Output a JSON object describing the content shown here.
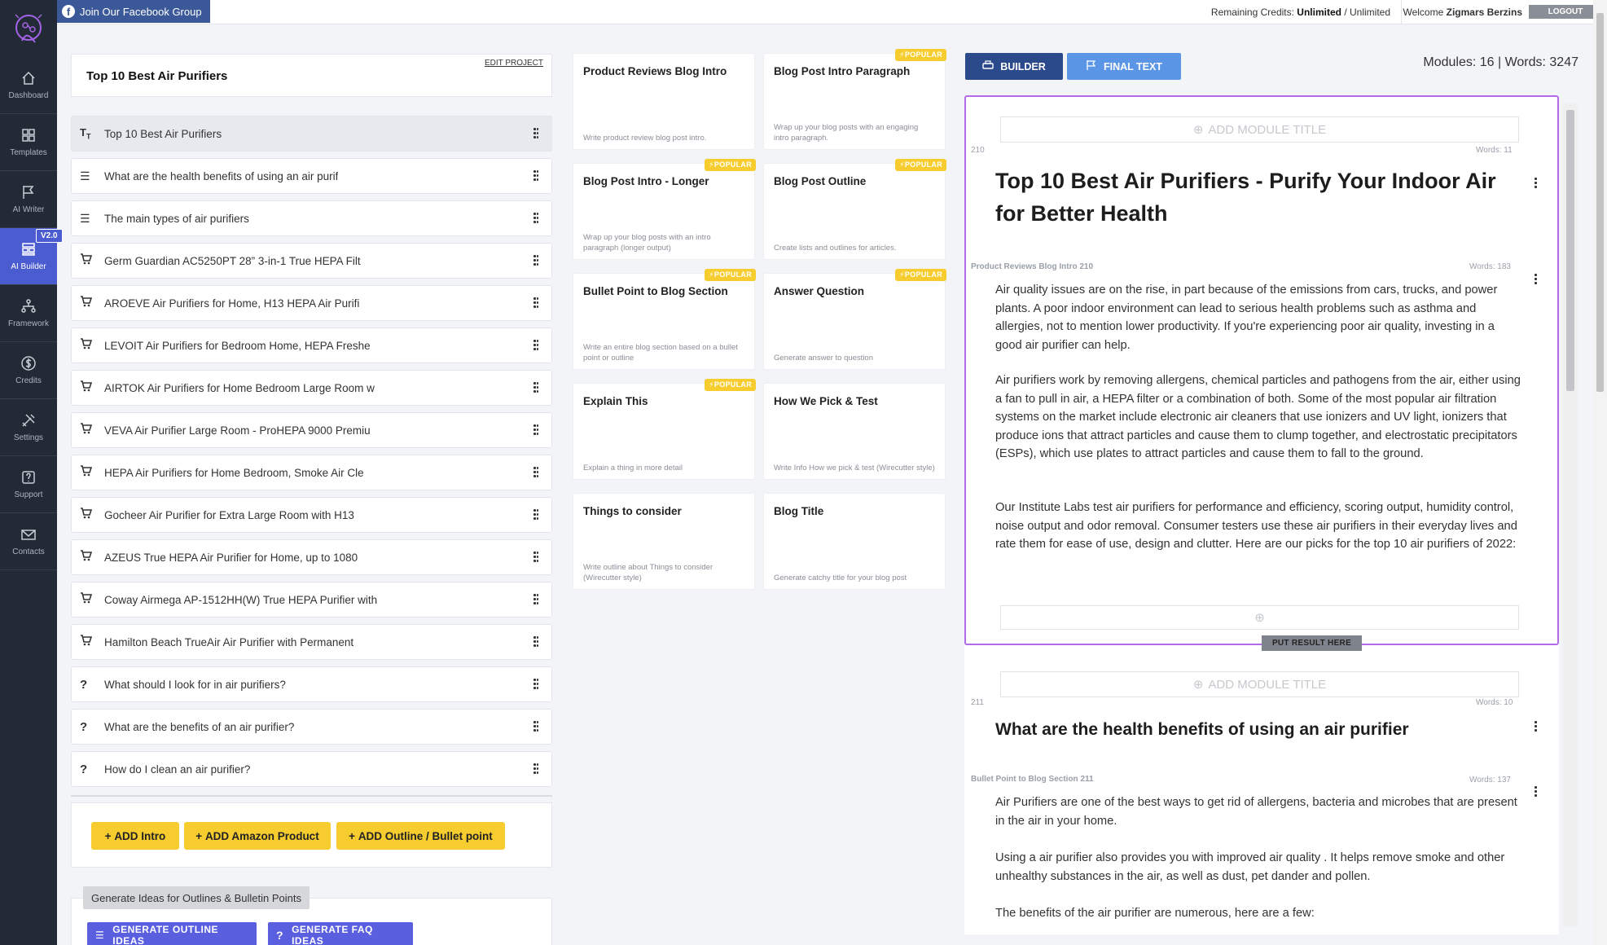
{
  "sidebar": {
    "badge": "V2.0",
    "items": [
      {
        "label": "Dashboard",
        "icon": "home-icon"
      },
      {
        "label": "Templates",
        "icon": "grid-icon"
      },
      {
        "label": "AI Writer",
        "icon": "flag-icon"
      },
      {
        "label": "AI Builder",
        "icon": "builder-icon",
        "active": true
      },
      {
        "label": "Framework",
        "icon": "framework-icon"
      },
      {
        "label": "Credits",
        "icon": "dollar-icon"
      },
      {
        "label": "Settings",
        "icon": "tools-icon"
      },
      {
        "label": "Support",
        "icon": "question-icon"
      },
      {
        "label": "Contacts",
        "icon": "mail-icon"
      }
    ]
  },
  "topbar": {
    "facebook_label": "Join Our Facebook Group",
    "credits_prefix": "Remaining Credits:",
    "credits_value": "Unlimited",
    "credits_total": "/ Unlimited",
    "welcome_prefix": "Welcome",
    "user_name": "Zigmars Berzins",
    "logout_label": "LOGOUT"
  },
  "project": {
    "title": "Top 10 Best Air Purifiers",
    "edit_label": "EDIT PROJECT"
  },
  "outline": [
    {
      "type": "title",
      "text": "Top 10 Best Air Purifiers"
    },
    {
      "type": "list",
      "text": "What are the health benefits of using an air purif"
    },
    {
      "type": "list",
      "text": "The main types of air purifiers"
    },
    {
      "type": "product",
      "text": "Germ Guardian AC5250PT 28” 3-in-1 True HEPA Filt"
    },
    {
      "type": "product",
      "text": "AROEVE Air Purifiers for Home, H13 HEPA Air Purifi"
    },
    {
      "type": "product",
      "text": "LEVOIT Air Purifiers for Bedroom Home, HEPA Freshe"
    },
    {
      "type": "product",
      "text": "AIRTOK Air Purifiers for Home Bedroom Large Room w"
    },
    {
      "type": "product",
      "text": "VEVA Air Purifier Large Room - ProHEPA 9000 Premiu"
    },
    {
      "type": "product",
      "text": "HEPA Air Purifiers for Home Bedroom, Smoke Air Cle"
    },
    {
      "type": "product",
      "text": "Gocheer Air Purifier for Extra Large Room with H13"
    },
    {
      "type": "product",
      "text": "AZEUS True HEPA Air Purifier for Home, up to 1080"
    },
    {
      "type": "product",
      "text": "Coway Airmega AP-1512HH(W) True HEPA Purifier with"
    },
    {
      "type": "product",
      "text": "Hamilton Beach TrueAir Air Purifier with Permanent"
    },
    {
      "type": "question",
      "text": "What should I look for in air purifiers?"
    },
    {
      "type": "question",
      "text": "What are the benefits of an air purifier?"
    },
    {
      "type": "question",
      "text": "How do I clean an air purifier?"
    }
  ],
  "add_buttons": {
    "intro": "ADD Intro",
    "amazon": "ADD Amazon Product",
    "outline": "ADD Outline / Bullet point"
  },
  "generate": {
    "label": "Generate Ideas for Outlines & Bulletin Points",
    "outline_btn": "GENERATE OUTLINE IDEAS",
    "faq_btn": "GENERATE FAQ IDEAS"
  },
  "templates": [
    {
      "title": "Product Reviews Blog Intro",
      "desc": "Write product review blog post intro.",
      "popular": false
    },
    {
      "title": "Blog Post Intro Paragraph",
      "desc": "Wrap up your blog posts with an engaging intro paragraph.",
      "popular": true
    },
    {
      "title": "Blog Post Intro - Longer",
      "desc": "Wrap up your blog posts with an intro paragraph (longer output)",
      "popular": true
    },
    {
      "title": "Blog Post Outline",
      "desc": "Create lists and outlines for articles.",
      "popular": true
    },
    {
      "title": "Bullet Point to Blog Section",
      "desc": "Write an entire blog section based on a bullet point or outline",
      "popular": true
    },
    {
      "title": "Answer Question",
      "desc": "Generate answer to question",
      "popular": true
    },
    {
      "title": "Explain This",
      "desc": "Explain a thing in more detail",
      "popular": true
    },
    {
      "title": "How We Pick & Test",
      "desc": "Write Info How we pick & test (Wirecutter style)",
      "popular": false
    },
    {
      "title": "Things to consider",
      "desc": "Write outline about Things to consider (Wirecutter style)",
      "popular": false
    },
    {
      "title": "Blog Title",
      "desc": "Generate catchy title for your blog post",
      "popular": false
    }
  ],
  "popular_label": "POPULAR",
  "builder": {
    "builder_btn": "BUILDER",
    "final_btn": "FINAL TEXT",
    "stats": "Modules: 16 | Words: 3247",
    "add_module_title": "ADD MODULE TITLE",
    "put_result": "PUT RESULT HERE",
    "colors": {
      "builder": "#2b4a8b",
      "final": "#5b96e6",
      "active_border": "#b36ae8"
    },
    "modules": [
      {
        "id": "210",
        "title_words": "Words: 11",
        "heading": "Top 10 Best Air Purifiers - Purify Your Indoor Air for Better Health",
        "source": "Product Reviews Blog Intro 210",
        "body_words": "Words: 183",
        "paragraphs": [
          "Air quality issues are on the rise, in part because of the emissions from cars, trucks, and power plants. A poor indoor environment can lead to serious health problems such as asthma and allergies, not to mention lower productivity. If you're experiencing poor air quality, investing in a good air purifier can help.",
          "Air purifiers work by removing allergens, chemical particles and pathogens from the air, either using a fan to pull in air, a HEPA filter or a combination of both. Some of the most popular air filtration systems on the market include electronic air cleaners that use ionizers and UV light, ionizers that produce ions that attract particles and cause them to clump together, and electrostatic precipitators (ESPs), which use plates to attract particles and cause them to fall to the ground.",
          "Our Institute Labs test air purifiers for performance and efficiency, scoring output, humidity control, noise output and odor removal. Consumer testers use these air purifiers in their everyday lives and rate them for ease of use, design and clutter. Here are our picks for the top 10 air purifiers of 2022:"
        ]
      },
      {
        "id": "211",
        "title_words": "Words: 10",
        "heading": "What are the health benefits of using an air purifier",
        "source": "Bullet Point to Blog Section 211",
        "body_words": "Words: 137",
        "paragraphs": [
          "Air Purifiers are one of the best ways to get rid of allergens, bacteria and microbes that are present in the air in your home.",
          "Using a air purifier also provides you with improved air quality . It helps remove smoke and other unhealthy substances in the air, as well as dust, pet dander and pollen.",
          "The benefits of the air purifier are numerous, here are a few:"
        ]
      }
    ]
  }
}
